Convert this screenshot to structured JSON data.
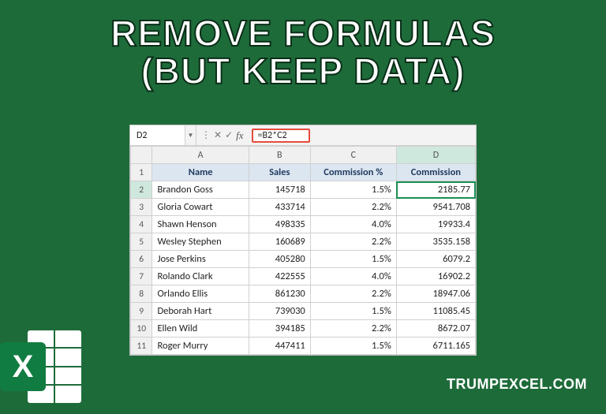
{
  "title_line1": "REMOVE FORMULAS",
  "title_line2": "(BUT KEEP DATA)",
  "watermark": "TRUMPEXCEL.COM",
  "formula_bar": {
    "name_box": "D2",
    "formula": "=B2*C2",
    "fx_label": "fx"
  },
  "columns": [
    "A",
    "B",
    "C",
    "D"
  ],
  "headers": {
    "name": "Name",
    "sales": "Sales",
    "commission_pct": "Commission %",
    "commission": "Commission"
  },
  "rows": [
    {
      "n": "2",
      "name": "Brandon Goss",
      "sales": "145718",
      "pct": "1.5%",
      "comm": "2185.77"
    },
    {
      "n": "3",
      "name": "Gloria Cowart",
      "sales": "433714",
      "pct": "2.2%",
      "comm": "9541.708"
    },
    {
      "n": "4",
      "name": "Shawn Henson",
      "sales": "498335",
      "pct": "4.0%",
      "comm": "19933.4"
    },
    {
      "n": "5",
      "name": "Wesley Stephen",
      "sales": "160689",
      "pct": "2.2%",
      "comm": "3535.158"
    },
    {
      "n": "6",
      "name": "Jose Perkins",
      "sales": "405280",
      "pct": "1.5%",
      "comm": "6079.2"
    },
    {
      "n": "7",
      "name": "Rolando Clark",
      "sales": "422555",
      "pct": "4.0%",
      "comm": "16902.2"
    },
    {
      "n": "8",
      "name": "Orlando Ellis",
      "sales": "861230",
      "pct": "2.2%",
      "comm": "18947.06"
    },
    {
      "n": "9",
      "name": "Deborah Hart",
      "sales": "739030",
      "pct": "1.5%",
      "comm": "11085.45"
    },
    {
      "n": "10",
      "name": "Ellen Wild",
      "sales": "394185",
      "pct": "2.2%",
      "comm": "8672.07"
    },
    {
      "n": "11",
      "name": "Roger Murry",
      "sales": "447411",
      "pct": "1.5%",
      "comm": "6711.165"
    }
  ]
}
